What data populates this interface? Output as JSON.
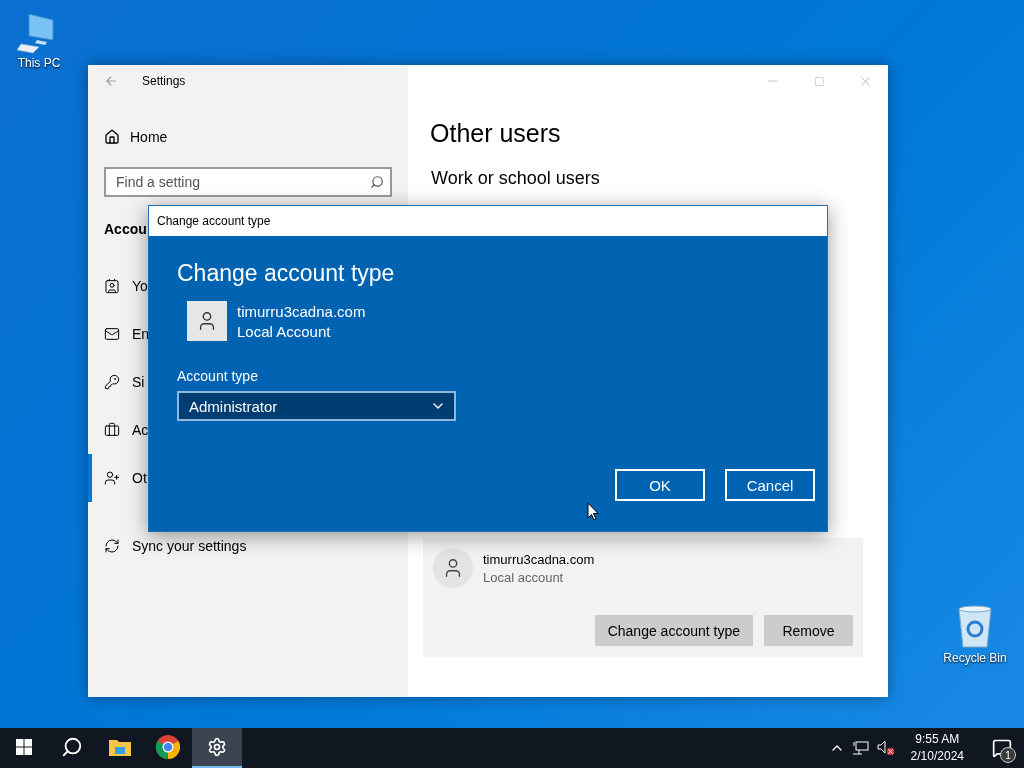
{
  "desktop_icons": [
    {
      "label": "This PC"
    },
    {
      "label": "Recycle Bin"
    }
  ],
  "settings": {
    "title": "Settings",
    "home": "Home",
    "search": {
      "placeholder": "Find a setting"
    },
    "section": "Accou",
    "nav": [
      {
        "label": "Yo",
        "selected": false
      },
      {
        "label": "En",
        "selected": false
      },
      {
        "label": "Si",
        "selected": false
      },
      {
        "label": "Ac",
        "selected": false
      },
      {
        "label": "Ot",
        "selected": true
      },
      {
        "label": "Sync your settings",
        "selected": false
      }
    ],
    "heading": "Other users",
    "subheading": "Work or school users",
    "user": {
      "name": "timurru3cadna.com",
      "type": "Local account"
    },
    "buttons": [
      "Change account type",
      "Remove"
    ]
  },
  "dialog": {
    "title": "Change account type",
    "heading": "Change account type",
    "user_name": "timurru3cadna.com",
    "user_type": "Local Account",
    "field_label": "Account type",
    "value": "Administrator",
    "buttons": [
      "OK",
      "Cancel"
    ]
  },
  "taskbar": {
    "apps": [
      {
        "kind": "start",
        "selected": false
      },
      {
        "kind": "search",
        "selected": false
      },
      {
        "kind": "explorer",
        "selected": false
      },
      {
        "kind": "chrome",
        "selected": false
      },
      {
        "kind": "settings",
        "selected": true
      }
    ],
    "time": "9:55 AM",
    "date": "2/10/2024",
    "notifications": "1"
  }
}
